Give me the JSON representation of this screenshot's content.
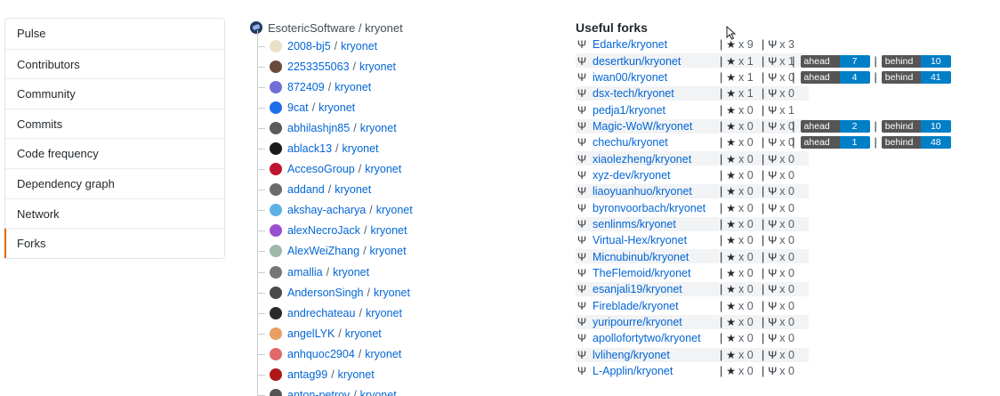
{
  "sidebar": {
    "items": [
      {
        "label": "Pulse"
      },
      {
        "label": "Contributors"
      },
      {
        "label": "Community"
      },
      {
        "label": "Commits"
      },
      {
        "label": "Code frequency"
      },
      {
        "label": "Dependency graph"
      },
      {
        "label": "Network"
      },
      {
        "label": "Forks",
        "selected": true
      }
    ]
  },
  "tree": {
    "root": "EsotericSoftware / kryonet",
    "items": [
      {
        "owner": "2008-bj5",
        "repo": "kryonet",
        "avatar_color": "#e8e0c8"
      },
      {
        "owner": "2253355063",
        "repo": "kryonet",
        "avatar_color": "#6a4a3a"
      },
      {
        "owner": "872409",
        "repo": "kryonet",
        "avatar_color": "#6f6fd6"
      },
      {
        "owner": "9cat",
        "repo": "kryonet",
        "avatar_color": "#1f6feb"
      },
      {
        "owner": "abhilashjn85",
        "repo": "kryonet",
        "avatar_color": "#5a5a5a"
      },
      {
        "owner": "ablack13",
        "repo": "kryonet",
        "avatar_color": "#1a1a1a"
      },
      {
        "owner": "AccesoGroup",
        "repo": "kryonet",
        "avatar_color": "#c0152f"
      },
      {
        "owner": "addand",
        "repo": "kryonet",
        "avatar_color": "#6b6b6b"
      },
      {
        "owner": "akshay-acharya",
        "repo": "kryonet",
        "avatar_color": "#5fb0e6"
      },
      {
        "owner": "alexNecroJack",
        "repo": "kryonet",
        "avatar_color": "#9a4fd0"
      },
      {
        "owner": "AlexWeiZhang",
        "repo": "kryonet",
        "avatar_color": "#9fb8a8"
      },
      {
        "owner": "amallia",
        "repo": "kryonet",
        "avatar_color": "#777777"
      },
      {
        "owner": "AndersonSingh",
        "repo": "kryonet",
        "avatar_color": "#4a4a4a"
      },
      {
        "owner": "andrechateau",
        "repo": "kryonet",
        "avatar_color": "#2a2a2a"
      },
      {
        "owner": "angelLYK",
        "repo": "kryonet",
        "avatar_color": "#e8a060"
      },
      {
        "owner": "anhquoc2904",
        "repo": "kryonet",
        "avatar_color": "#e06a6a"
      },
      {
        "owner": "antag99",
        "repo": "kryonet",
        "avatar_color": "#b01818"
      },
      {
        "owner": "anton-petrov",
        "repo": "kryonet",
        "avatar_color": "#555555"
      }
    ]
  },
  "forks": {
    "title": "Useful forks",
    "ahead_label": "ahead",
    "behind_label": "behind",
    "rows": [
      {
        "name": "Edarke/kryonet",
        "stars": "x 9",
        "forks": "x 3",
        "ahead": "",
        "behind": ""
      },
      {
        "name": "desertkun/kryonet",
        "stars": "x 1",
        "forks": "x 1",
        "ahead": "7",
        "behind": "10"
      },
      {
        "name": "iwan00/kryonet",
        "stars": "x 1",
        "forks": "x 0",
        "ahead": "4",
        "behind": "41"
      },
      {
        "name": "dsx-tech/kryonet",
        "stars": "x 1",
        "forks": "x 0",
        "ahead": "",
        "behind": ""
      },
      {
        "name": "pedja1/kryonet",
        "stars": "x 0",
        "forks": "x 1",
        "ahead": "",
        "behind": ""
      },
      {
        "name": "Magic-WoW/kryonet",
        "stars": "x 0",
        "forks": "x 0",
        "ahead": "2",
        "behind": "10"
      },
      {
        "name": "chechu/kryonet",
        "stars": "x 0",
        "forks": "x 0",
        "ahead": "1",
        "behind": "48"
      },
      {
        "name": "xiaolezheng/kryonet",
        "stars": "x 0",
        "forks": "x 0",
        "ahead": "",
        "behind": ""
      },
      {
        "name": "xyz-dev/kryonet",
        "stars": "x 0",
        "forks": "x 0",
        "ahead": "",
        "behind": ""
      },
      {
        "name": "liaoyuanhuo/kryonet",
        "stars": "x 0",
        "forks": "x 0",
        "ahead": "",
        "behind": ""
      },
      {
        "name": "byronvoorbach/kryonet",
        "stars": "x 0",
        "forks": "x 0",
        "ahead": "",
        "behind": ""
      },
      {
        "name": "senlinms/kryonet",
        "stars": "x 0",
        "forks": "x 0",
        "ahead": "",
        "behind": ""
      },
      {
        "name": "Virtual-Hex/kryonet",
        "stars": "x 0",
        "forks": "x 0",
        "ahead": "",
        "behind": ""
      },
      {
        "name": "Micnubinub/kryonet",
        "stars": "x 0",
        "forks": "x 0",
        "ahead": "",
        "behind": ""
      },
      {
        "name": "TheFlemoid/kryonet",
        "stars": "x 0",
        "forks": "x 0",
        "ahead": "",
        "behind": ""
      },
      {
        "name": "esanjali19/kryonet",
        "stars": "x 0",
        "forks": "x 0",
        "ahead": "",
        "behind": ""
      },
      {
        "name": "Fireblade/kryonet",
        "stars": "x 0",
        "forks": "x 0",
        "ahead": "",
        "behind": ""
      },
      {
        "name": "yuripourre/kryonet",
        "stars": "x 0",
        "forks": "x 0",
        "ahead": "",
        "behind": ""
      },
      {
        "name": "apollofortytwo/kryonet",
        "stars": "x 0",
        "forks": "x 0",
        "ahead": "",
        "behind": ""
      },
      {
        "name": "lvliheng/kryonet",
        "stars": "x 0",
        "forks": "x 0",
        "ahead": "",
        "behind": ""
      },
      {
        "name": "L-Applin/kryonet",
        "stars": "x 0",
        "forks": "x 0",
        "ahead": "",
        "behind": ""
      }
    ]
  },
  "colors": {
    "link": "#0366d6",
    "selected_accent": "#e36209",
    "badge_label": "#555555",
    "badge_value": "#007ec6"
  },
  "icons": {
    "fork": "fork-icon",
    "star": "star-icon",
    "cursor": "mouse-pointer-icon"
  }
}
